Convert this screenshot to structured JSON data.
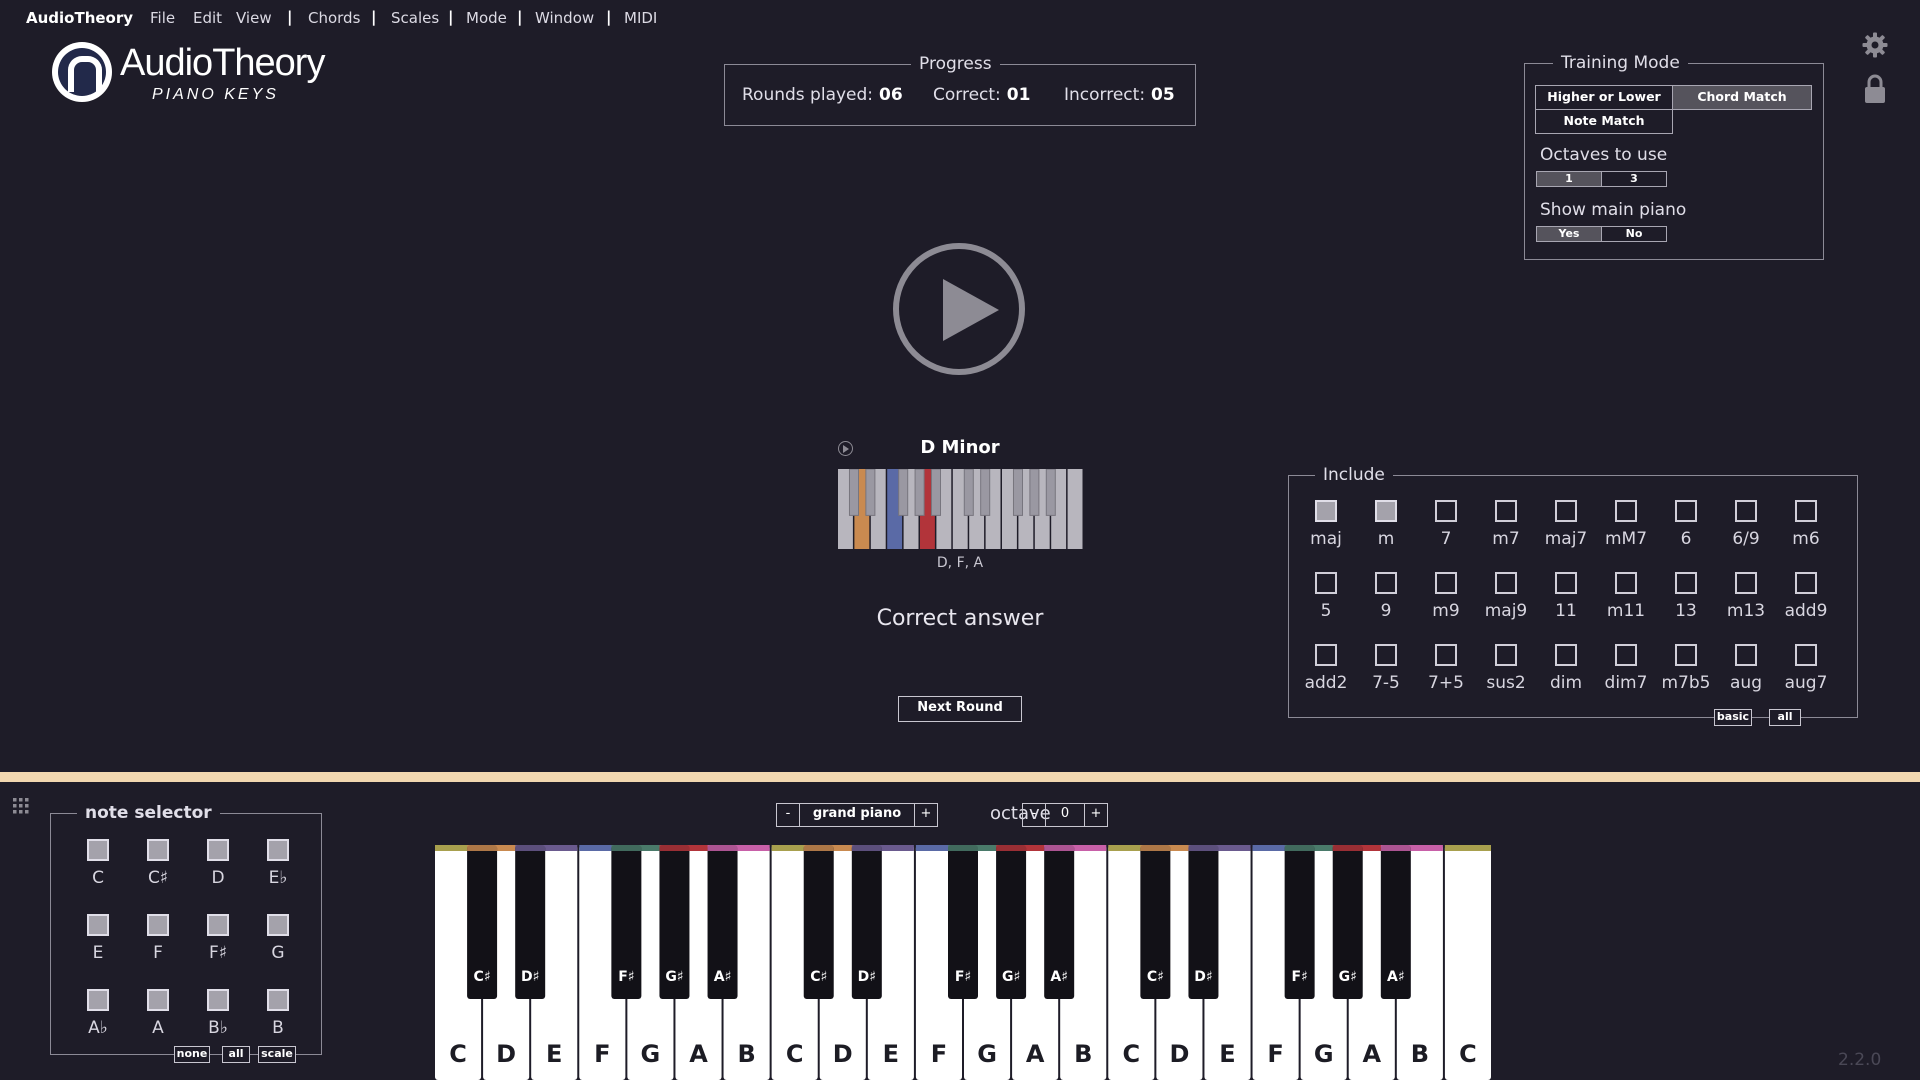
{
  "menu": {
    "brand": "AudioTheory",
    "items": [
      "File",
      "Edit",
      "View",
      "Chords",
      "Scales",
      "Mode",
      "Window",
      "MIDI"
    ]
  },
  "logo": {
    "word": "AudioTheory",
    "sub": "PIANO KEYS"
  },
  "progress": {
    "title": "Progress",
    "rounds_label": "Rounds played:",
    "rounds_value": "06",
    "correct_label": "Correct:",
    "correct_value": "01",
    "incorrect_label": "Incorrect:",
    "incorrect_value": "05"
  },
  "training": {
    "title": "Training Mode",
    "modes": [
      {
        "label": "Higher or Lower",
        "active": false
      },
      {
        "label": "Chord Match",
        "active": true
      },
      {
        "label": "Note Match",
        "active": false
      }
    ],
    "octaves_label": "Octaves to use",
    "octaves": [
      {
        "label": "1",
        "active": true
      },
      {
        "label": "3",
        "active": false
      }
    ],
    "show_piano_label": "Show main piano",
    "show_piano": [
      {
        "label": "Yes",
        "active": true
      },
      {
        "label": "No",
        "active": false
      }
    ]
  },
  "chord": {
    "name": "D Minor",
    "notes": "D, F, A",
    "highlight_colors": {
      "D": "#c98a50",
      "F": "#5a6aa6",
      "A": "#b2343a"
    }
  },
  "feedback": "Correct answer",
  "next_round": "Next Round",
  "include": {
    "title": "Include",
    "items": [
      {
        "label": "maj",
        "checked": true
      },
      {
        "label": "m",
        "checked": true
      },
      {
        "label": "7",
        "checked": false
      },
      {
        "label": "m7",
        "checked": false
      },
      {
        "label": "maj7",
        "checked": false
      },
      {
        "label": "mM7",
        "checked": false
      },
      {
        "label": "6",
        "checked": false
      },
      {
        "label": "6/9",
        "checked": false
      },
      {
        "label": "m6",
        "checked": false
      },
      {
        "label": "5",
        "checked": false
      },
      {
        "label": "9",
        "checked": false
      },
      {
        "label": "m9",
        "checked": false
      },
      {
        "label": "maj9",
        "checked": false
      },
      {
        "label": "11",
        "checked": false
      },
      {
        "label": "m11",
        "checked": false
      },
      {
        "label": "13",
        "checked": false
      },
      {
        "label": "m13",
        "checked": false
      },
      {
        "label": "add9",
        "checked": false
      },
      {
        "label": "add2",
        "checked": false
      },
      {
        "label": "7-5",
        "checked": false
      },
      {
        "label": "7+5",
        "checked": false
      },
      {
        "label": "sus2",
        "checked": false
      },
      {
        "label": "dim",
        "checked": false
      },
      {
        "label": "dim7",
        "checked": false
      },
      {
        "label": "m7b5",
        "checked": false
      },
      {
        "label": "aug",
        "checked": false
      },
      {
        "label": "aug7",
        "checked": false
      }
    ],
    "basic_label": "basic",
    "all_label": "all"
  },
  "note_selector": {
    "title": "note selector",
    "notes": [
      "C",
      "C♯",
      "D",
      "E♭",
      "E",
      "F",
      "F♯",
      "G",
      "A♭",
      "A",
      "B♭",
      "B"
    ],
    "none_label": "none",
    "all_label": "all",
    "scale_label": "scale"
  },
  "instrument": {
    "minus": "-",
    "name": "grand piano",
    "plus": "+"
  },
  "octave": {
    "label": "octave",
    "minus": "-",
    "value": "0",
    "plus": "+"
  },
  "piano": {
    "white_labels": [
      "C",
      "D",
      "E",
      "F",
      "G",
      "A",
      "B",
      "C",
      "D",
      "E",
      "F",
      "G",
      "A",
      "B",
      "C",
      "D",
      "E",
      "F",
      "G",
      "A",
      "B",
      "C"
    ],
    "black_labels": [
      "C♯",
      "D♯",
      "F♯",
      "G♯",
      "A♯",
      "C♯",
      "D♯",
      "F♯",
      "G♯",
      "A♯",
      "C♯",
      "D♯",
      "F♯",
      "G♯",
      "A♯"
    ],
    "note_colors": [
      "#a8a04e",
      "#c98a50",
      "#6a5a8e",
      "#5a6aa6",
      "#4a7a6a",
      "#b2343a",
      "#c860a8"
    ]
  },
  "version": "2.2.0"
}
